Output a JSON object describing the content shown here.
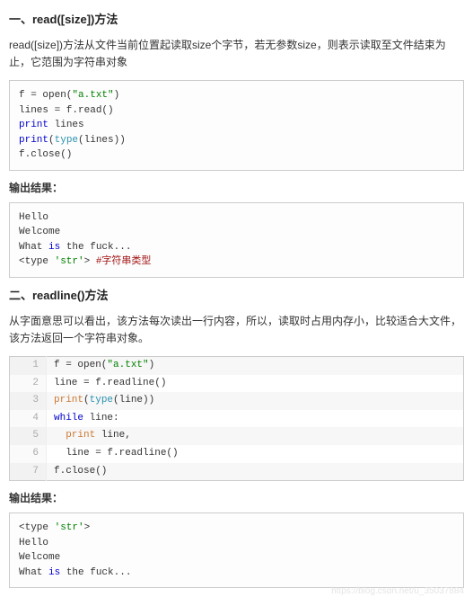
{
  "section1": {
    "heading": "一、read([size])方法",
    "desc": "read([size])方法从文件当前位置起读取size个字节，若无参数size，则表示读取至文件结束为止，它范围为字符串对象",
    "code_lines": [
      [
        {
          "t": "f = open(",
          "c": ""
        },
        {
          "t": "\"a.txt\"",
          "c": "k-green"
        },
        {
          "t": ")",
          "c": ""
        }
      ],
      [
        {
          "t": "lines = f.read()",
          "c": ""
        }
      ],
      [
        {
          "t": "print",
          "c": "k-blue"
        },
        {
          "t": " lines",
          "c": ""
        }
      ],
      [
        {
          "t": "print",
          "c": "k-blue"
        },
        {
          "t": "(",
          "c": ""
        },
        {
          "t": "type",
          "c": "k-teal"
        },
        {
          "t": "(lines))",
          "c": ""
        }
      ],
      [
        {
          "t": "f.close()",
          "c": ""
        }
      ]
    ],
    "out_label": "输出结果：",
    "out_lines": [
      [
        {
          "t": "Hello",
          "c": ""
        }
      ],
      [
        {
          "t": "Welcome",
          "c": ""
        }
      ],
      [
        {
          "t": "What ",
          "c": ""
        },
        {
          "t": "is",
          "c": "k-blue"
        },
        {
          "t": " the fuck...",
          "c": ""
        }
      ],
      [
        {
          "t": "<type ",
          "c": ""
        },
        {
          "t": "'str'",
          "c": "k-green"
        },
        {
          "t": ">",
          "c": ""
        },
        {
          "t": " #字符串类型",
          "c": "k-red"
        }
      ]
    ]
  },
  "section2": {
    "heading": "二、readline()方法",
    "desc": "从字面意思可以看出，该方法每次读出一行内容，所以，读取时占用内存小，比较适合大文件，该方法返回一个字符串对象。",
    "code_rows": [
      {
        "n": "1",
        "segs": [
          {
            "t": "f = open(",
            "c": ""
          },
          {
            "t": "\"a.txt\"",
            "c": "k-green"
          },
          {
            "t": ")",
            "c": ""
          }
        ]
      },
      {
        "n": "2",
        "segs": [
          {
            "t": "line = f.readline()",
            "c": ""
          }
        ]
      },
      {
        "n": "3",
        "segs": [
          {
            "t": "print",
            "c": "k-orange"
          },
          {
            "t": "(",
            "c": ""
          },
          {
            "t": "type",
            "c": "k-teal"
          },
          {
            "t": "(line))",
            "c": ""
          }
        ]
      },
      {
        "n": "4",
        "segs": [
          {
            "t": "while",
            "c": "k-blue"
          },
          {
            "t": " line:",
            "c": ""
          }
        ]
      },
      {
        "n": "5",
        "segs": [
          {
            "t": "  ",
            "c": ""
          },
          {
            "t": "print",
            "c": "k-orange"
          },
          {
            "t": " line,",
            "c": ""
          }
        ]
      },
      {
        "n": "6",
        "segs": [
          {
            "t": "  line = f.readline()",
            "c": ""
          }
        ]
      },
      {
        "n": "7",
        "segs": [
          {
            "t": "f.close()",
            "c": ""
          }
        ]
      }
    ],
    "out_label": "输出结果：",
    "out_lines": [
      [
        {
          "t": "<type ",
          "c": ""
        },
        {
          "t": "'str'",
          "c": "k-green"
        },
        {
          "t": ">",
          "c": ""
        }
      ],
      [
        {
          "t": "Hello",
          "c": ""
        }
      ],
      [
        {
          "t": "Welcome",
          "c": ""
        }
      ],
      [
        {
          "t": "What ",
          "c": ""
        },
        {
          "t": "is",
          "c": "k-blue"
        },
        {
          "t": " the fuck...",
          "c": ""
        }
      ]
    ]
  },
  "watermark": "https://blog.csdn.net/u_35037884"
}
